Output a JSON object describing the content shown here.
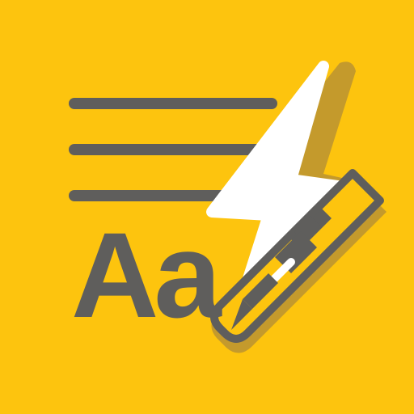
{
  "app_icon": {
    "name": "text-editor-app-icon",
    "logo_letters": "Aa",
    "icons": {
      "text_lines": "text-lines-icon",
      "lightning": "lightning-bolt-icon",
      "pen": "pen-icon"
    },
    "colors": {
      "background": "#FDC40E",
      "foreground": "#5F5E5C",
      "shadow": "#C49A2C",
      "lightning": "#FFFFFF",
      "pen_accent": "#FDC40E"
    }
  }
}
